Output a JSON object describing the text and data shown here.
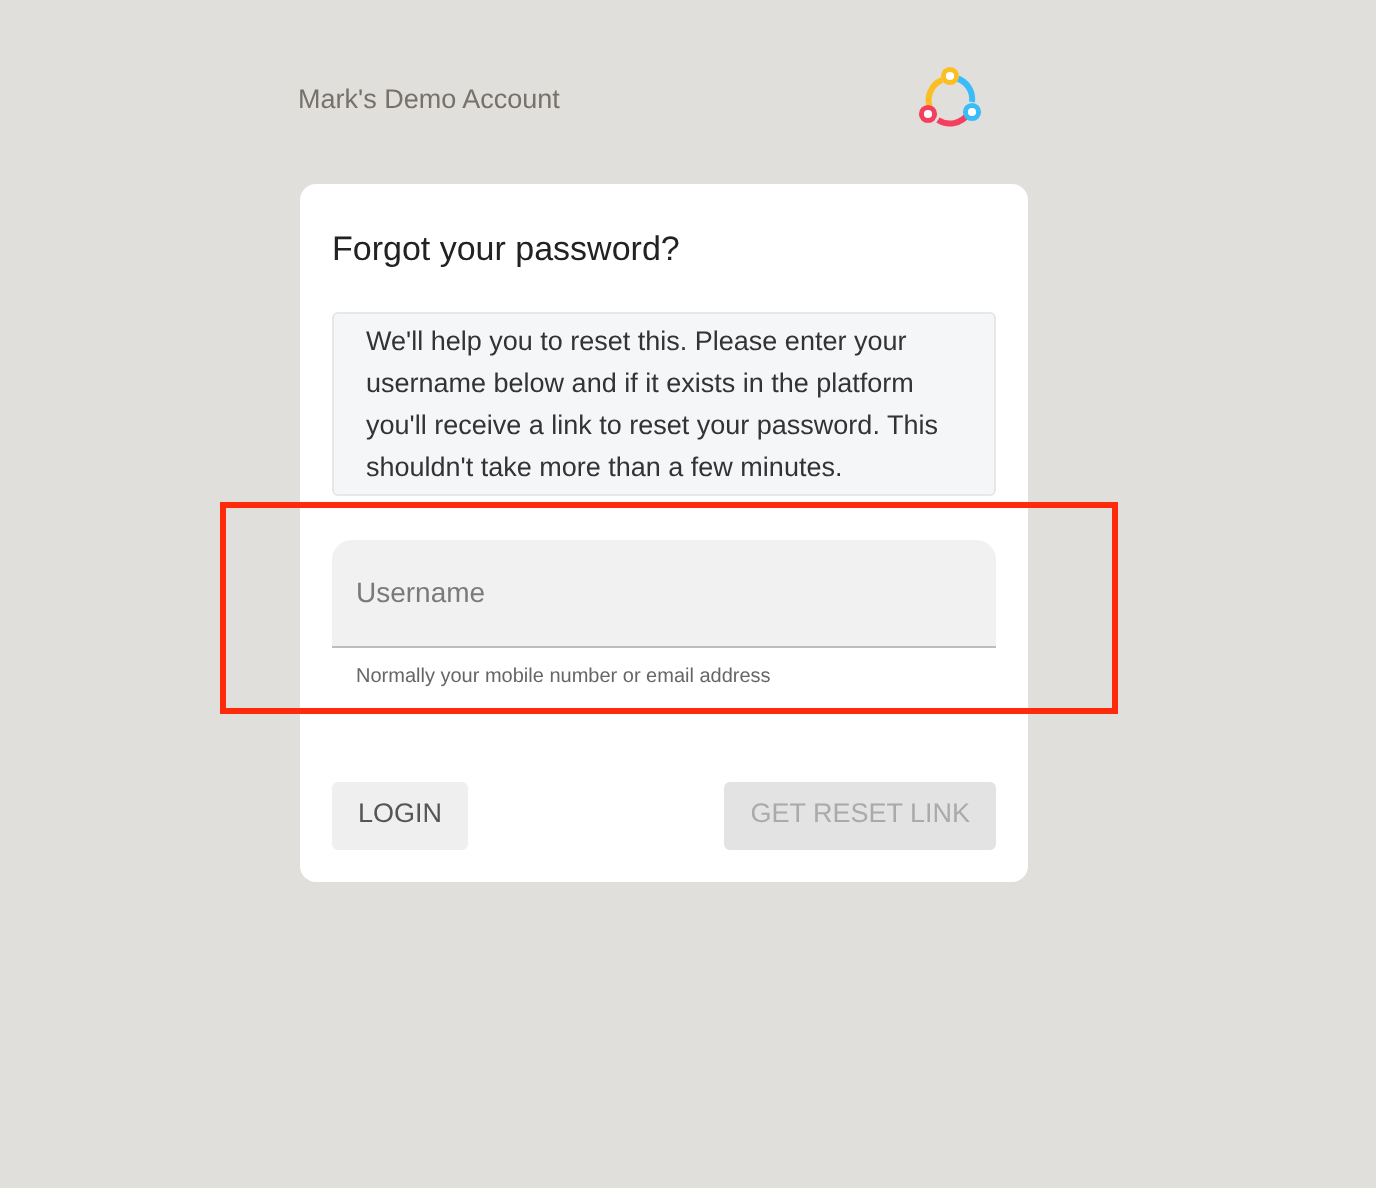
{
  "account_name": "Mark's Demo Account",
  "card": {
    "title": "Forgot your password?",
    "info": "We'll help you to reset this. Please enter your username below and if it exists in the platform you'll receive a link to reset your password. This shouldn't take more than a few minutes.",
    "username_field": {
      "placeholder": "Username",
      "helper": "Normally your mobile number or email address",
      "highlighted": true
    },
    "buttons": [
      {
        "label": "LOGIN",
        "disabled": false
      },
      {
        "label": "GET RESET LINK",
        "disabled": true
      }
    ]
  }
}
